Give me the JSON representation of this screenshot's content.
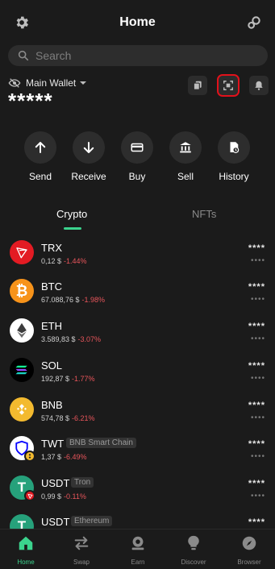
{
  "header": {
    "title": "Home",
    "left_icon": "gear-icon",
    "right_icon": "wallet-connect-icon"
  },
  "search": {
    "placeholder": "Search"
  },
  "wallet": {
    "name": "Main Wallet",
    "balance": "*****",
    "hide_icon": "eye-slash-icon"
  },
  "quick_buttons": [
    "copy-icon",
    "scan-icon",
    "bell-icon"
  ],
  "actions": [
    {
      "label": "Send",
      "icon": "arrow-up-icon"
    },
    {
      "label": "Receive",
      "icon": "arrow-down-icon"
    },
    {
      "label": "Buy",
      "icon": "card-icon"
    },
    {
      "label": "Sell",
      "icon": "bank-icon"
    },
    {
      "label": "History",
      "icon": "history-icon"
    }
  ],
  "tabs": {
    "crypto": "Crypto",
    "nfts": "NFTs"
  },
  "assets": [
    {
      "symbol": "TRX",
      "network": "",
      "price": "0,12 $",
      "change": "-1.44%",
      "hidden_amount": "****",
      "hidden_value": "••••",
      "color": "#e31b23"
    },
    {
      "symbol": "BTC",
      "network": "",
      "price": "67.088,76 $",
      "change": "-1.98%",
      "hidden_amount": "****",
      "hidden_value": "••••",
      "color": "#f7931a"
    },
    {
      "symbol": "ETH",
      "network": "",
      "price": "3.589,83 $",
      "change": "-3.07%",
      "hidden_amount": "****",
      "hidden_value": "••••",
      "color": "#ffffff"
    },
    {
      "symbol": "SOL",
      "network": "",
      "price": "192,87 $",
      "change": "-1.77%",
      "hidden_amount": "****",
      "hidden_value": "••••",
      "color": "#000000"
    },
    {
      "symbol": "BNB",
      "network": "",
      "price": "574,78 $",
      "change": "-6.21%",
      "hidden_amount": "****",
      "hidden_value": "••••",
      "color": "#f3ba2f"
    },
    {
      "symbol": "TWT",
      "network": "BNB Smart Chain",
      "price": "1,37 $",
      "change": "-6.49%",
      "hidden_amount": "****",
      "hidden_value": "••••",
      "color": "#ffffff"
    },
    {
      "symbol": "USDT",
      "network": "Tron",
      "price": "0,99 $",
      "change": "-0.11%",
      "hidden_amount": "****",
      "hidden_value": "••••",
      "color": "#26a17b"
    },
    {
      "symbol": "USDT",
      "network": "Ethereum",
      "price": "",
      "change": "",
      "hidden_amount": "****",
      "hidden_value": "",
      "color": "#26a17b"
    }
  ],
  "bottom_nav": [
    {
      "label": "Home",
      "icon": "home-icon",
      "active": true
    },
    {
      "label": "Swap",
      "icon": "swap-icon",
      "active": false
    },
    {
      "label": "Earn",
      "icon": "earn-icon",
      "active": false
    },
    {
      "label": "Discover",
      "icon": "discover-icon",
      "active": false
    },
    {
      "label": "Browser",
      "icon": "browser-icon",
      "active": false
    }
  ],
  "colors": {
    "accent": "#3bd38d",
    "negative": "#e8555b",
    "highlight": "#e2111b"
  }
}
